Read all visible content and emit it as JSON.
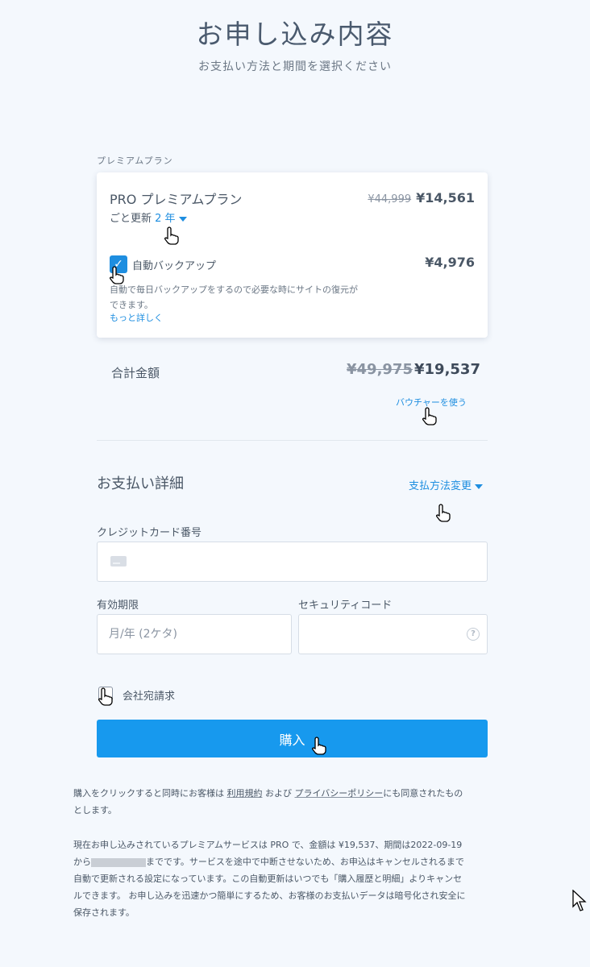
{
  "header": {
    "title": "お申し込み内容",
    "subtitle": "お支払い方法と期間を選択ください"
  },
  "plan_section_label": "プレミアムプラン",
  "plan": {
    "name": "PRO プレミアムプラン",
    "renew_prefix": "ごと更新",
    "renew_period": "2 年",
    "original_price": "¥44,999",
    "price": "¥14,561"
  },
  "backup": {
    "label": "自動バックアップ",
    "checked": true,
    "price": "¥4,976",
    "description": "自動で毎日バックアップをするので必要な時にサイトの復元ができます。",
    "more_link": "もっと詳しく"
  },
  "total": {
    "label": "合計金額",
    "original": "¥49,975",
    "price": "¥19,537",
    "voucher_link": "バウチャーを使う"
  },
  "payment": {
    "title": "お支払い詳細",
    "method_link": "支払方法変更",
    "card_label": "クレジットカード番号",
    "card_value": "",
    "expiry_label": "有効期限",
    "expiry_placeholder": "月/年 (2ケタ)",
    "cvc_label": "セキュリティコード",
    "cvc_value": ""
  },
  "company": {
    "label": "会社宛請求",
    "checked": false
  },
  "buy_button": "購入",
  "terms": {
    "part1": "購入をクリックすると同時にお客様は",
    "link1": "利用規約",
    "part2": "および",
    "link2": "プライバシーポリシー",
    "part3": "にも同意されたものとします。"
  },
  "notice": {
    "part1": "現在お申し込みされているプレミアムサービスは PRO で、金額は ¥19,537、期間は2022-09-19から",
    "part2": "までです。サービスを途中で中断させないため、お申込はキャンセルされるまで自動で更新される設定になっています。この自動更新はいつでも「購入履歴と明細」よりキャンセルできます。 お申し込みを迅速かつ簡単にするため、お客様のお支払いデータは暗号化され安全に保存されます。"
  },
  "colors": {
    "accent": "#1799ee",
    "link": "#1e8ee0",
    "background": "#f4f8fd"
  },
  "icons": [
    "credit-card-icon",
    "help-icon",
    "check-icon",
    "caret-down-icon",
    "hand-pointer-icon",
    "arrow-cursor-icon"
  ]
}
